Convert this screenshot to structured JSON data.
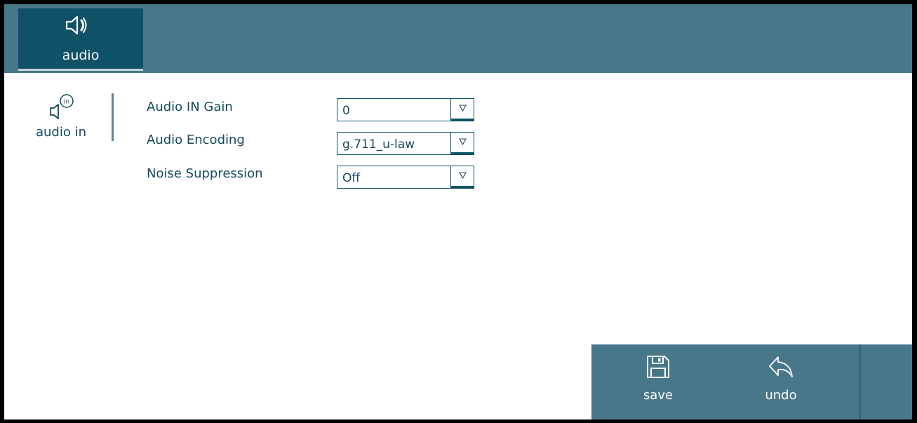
{
  "header": {
    "tab_label": "audio"
  },
  "subnav": {
    "item_label": "audio in"
  },
  "form": {
    "fields": [
      {
        "label": "Audio IN Gain",
        "value": "0"
      },
      {
        "label": "Audio Encoding",
        "value": "g.711_u-law"
      },
      {
        "label": "Noise Suppression",
        "value": "Off"
      }
    ]
  },
  "actions": {
    "save_label": "save",
    "undo_label": "undo"
  },
  "colors": {
    "bar": "#477789",
    "active_tab": "#0f5268",
    "text": "#174a5b",
    "background": "#ffffff"
  },
  "icons": {
    "tab": "speaker-icon",
    "subnav": "audio-in-icon",
    "save": "save-icon",
    "undo": "undo-icon",
    "dropdown": "triangle-down-icon"
  }
}
